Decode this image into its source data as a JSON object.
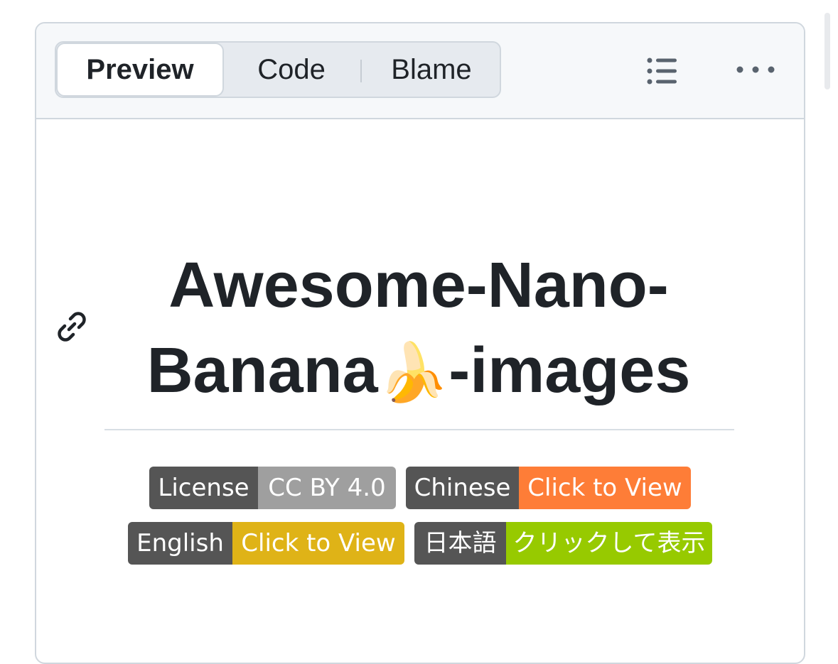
{
  "tabs": {
    "preview": "Preview",
    "code": "Code",
    "blame": "Blame"
  },
  "toolbar_icons": [
    "list-icon",
    "more-icon"
  ],
  "readme": {
    "title_line1": "Awesome-Nano-",
    "title_line2_a": "Banana",
    "title_emoji": "🍌",
    "title_line2_b": "-images"
  },
  "badges": {
    "license": {
      "label": "License",
      "message": "CC BY 4.0",
      "color": "#9f9f9f"
    },
    "chinese": {
      "label": "Chinese",
      "message": "Click to View",
      "color": "#fe7d37"
    },
    "english": {
      "label": "English",
      "message": "Click to View",
      "color": "#dfb317"
    },
    "japanese": {
      "label": "日本語",
      "message": "クリックして表示",
      "color": "#97ca00"
    }
  },
  "colors": {
    "badge_label_bg": "#555555",
    "border": "#d0d7de",
    "toolbar_bg": "#f6f8fa",
    "text": "#1f2328"
  }
}
